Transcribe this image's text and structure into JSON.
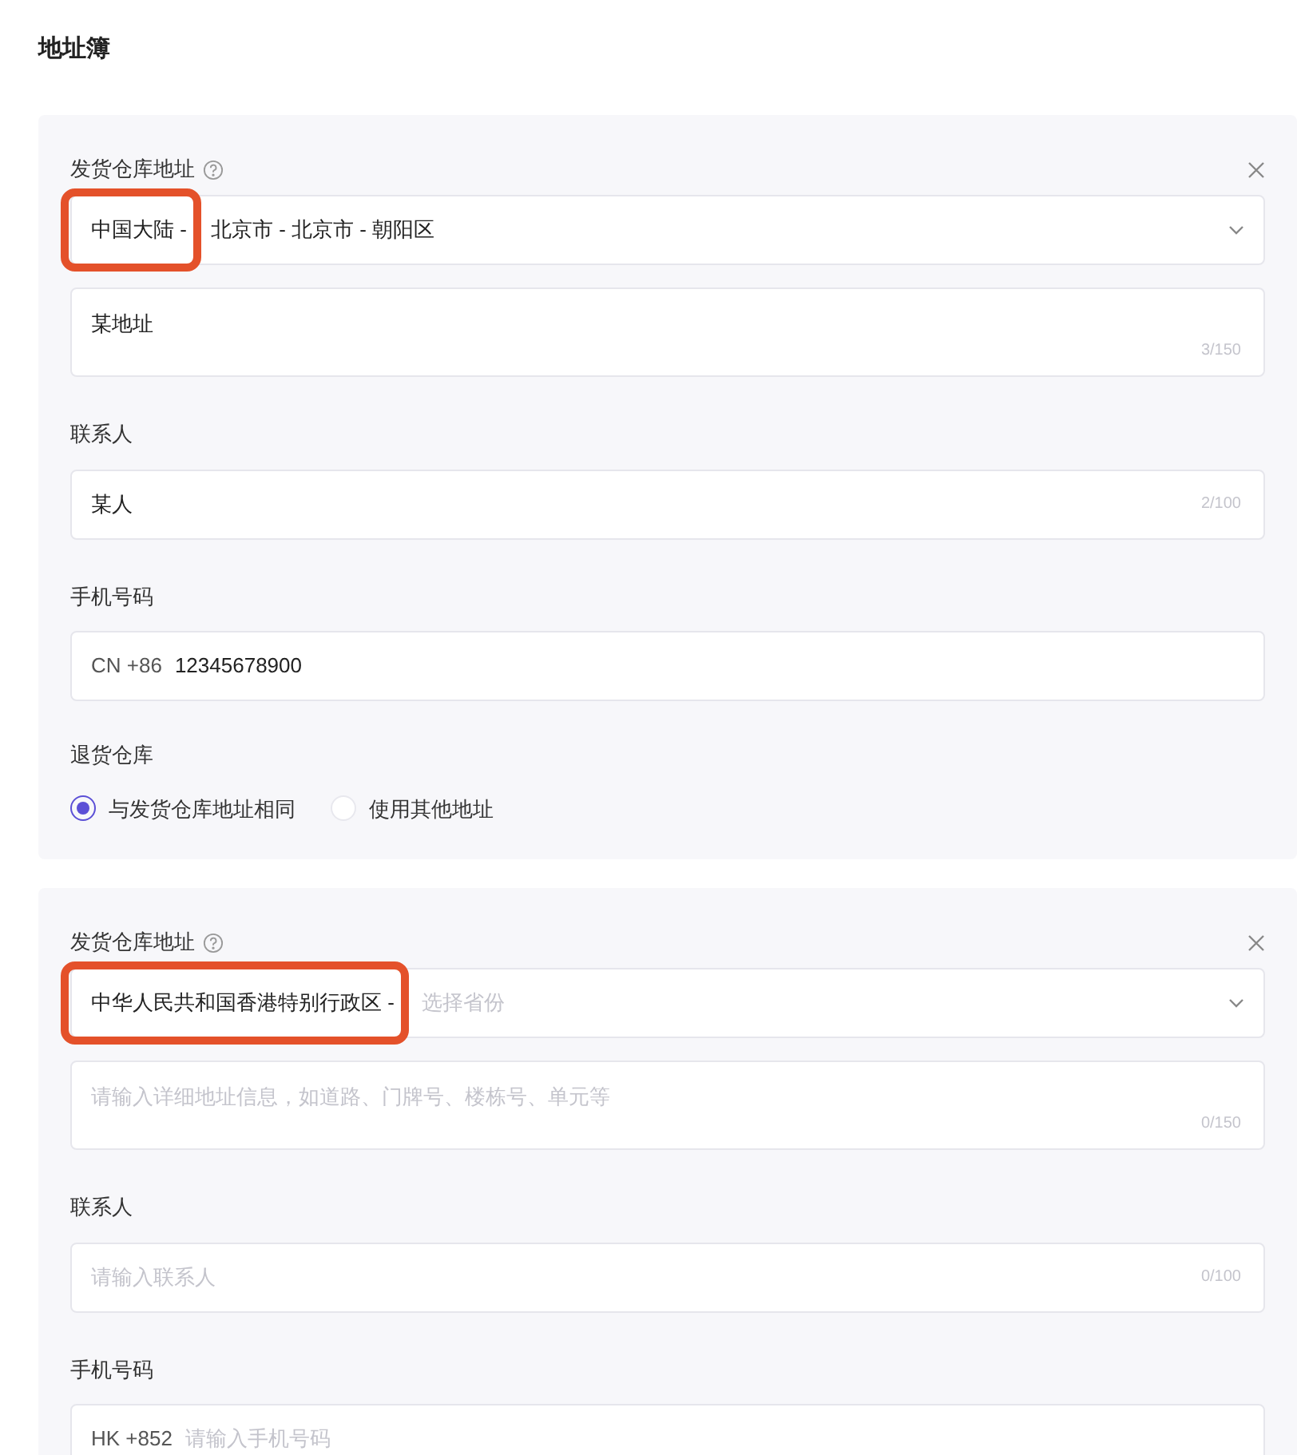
{
  "title": "地址簿",
  "warehouses": [
    {
      "label": "发货仓库地址",
      "region": {
        "lead": "中国大陆 -",
        "highlighted": true,
        "value": "北京市 - 北京市 - 朝阳区"
      },
      "address": {
        "value": "某地址",
        "counter": "3/150"
      },
      "contact_label": "联系人",
      "contact": {
        "value": "某人",
        "counter": "2/100"
      },
      "phone_label": "手机号码",
      "phone": {
        "prefix": "CN +86",
        "value": "12345678900"
      },
      "return_label": "退货仓库",
      "return_options": [
        {
          "label": "与发货仓库地址相同",
          "selected": true
        },
        {
          "label": "使用其他地址",
          "selected": false
        }
      ]
    },
    {
      "label": "发货仓库地址",
      "region": {
        "lead": "中华人民共和国香港特别行政区 -",
        "highlighted": true,
        "placeholder": "选择省份"
      },
      "address": {
        "placeholder": "请输入详细地址信息，如道路、门牌号、楼栋号、单元等",
        "counter": "0/150"
      },
      "contact_label": "联系人",
      "contact": {
        "placeholder": "请输入联系人",
        "counter": "0/100"
      },
      "phone_label": "手机号码",
      "phone": {
        "prefix": "HK +852",
        "placeholder": "请输入手机号码"
      }
    }
  ]
}
